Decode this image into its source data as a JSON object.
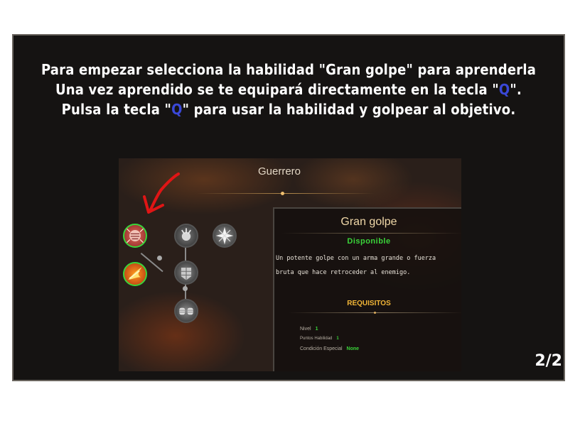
{
  "tutorial": {
    "line1": "Para empezar selecciona la habilidad \"Gran golpe\" para aprenderla",
    "line2_before": "Una vez aprendido se te equipará directamente en la tecla \"",
    "key": "Q",
    "line2_after": "\".",
    "line3_before": "Pulsa la tecla \"",
    "line3_after": "\" para usar la habilidad y golpear al objetivo.",
    "page": "2/2",
    "key_color": "#3a48d8"
  },
  "skill_tree": {
    "class_name": "Guerrero",
    "skills": [
      {
        "name": "gran-golpe",
        "state": "available"
      },
      {
        "name": "fire-slash",
        "state": "available"
      },
      {
        "name": "rage",
        "state": "locked"
      },
      {
        "name": "armor",
        "state": "locked"
      },
      {
        "name": "fists",
        "state": "locked"
      },
      {
        "name": "burst",
        "state": "locked"
      }
    ]
  },
  "skill_info": {
    "title": "Gran golpe",
    "status": "Disponible",
    "description": "Un potente golpe con un arma grande o fuerza\nbruta que hace retroceder al enemigo.",
    "requirements_title": "REQUISITOS",
    "requirements": [
      {
        "label": "Nivel",
        "value": "1"
      },
      {
        "label": "Puntos Habilidad",
        "value": "1"
      },
      {
        "label": "Condición Especial",
        "value": "None"
      }
    ]
  },
  "colors": {
    "available": "#3ad53a",
    "requirements": "#f2b637",
    "arrow": "#e01515"
  }
}
